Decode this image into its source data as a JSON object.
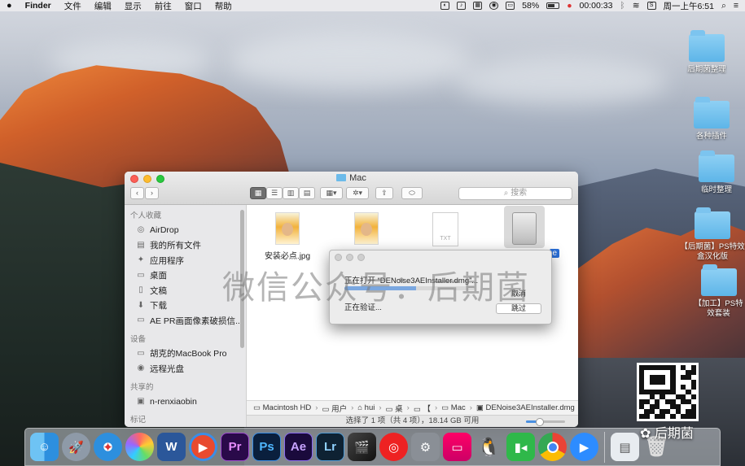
{
  "menubar": {
    "apple": "",
    "app_name": "Finder",
    "menus": [
      "文件",
      "编辑",
      "显示",
      "前往",
      "窗口",
      "帮助"
    ],
    "battery": "58%",
    "timer": "00:00:33",
    "clock": "周一上午6:51"
  },
  "desktop": {
    "items": [
      "后期菌整理",
      "各种插件",
      "临时整理",
      "【后期菌】PS特效盒汉化版",
      "【加工】PS特效套装"
    ]
  },
  "finder": {
    "title": "Mac",
    "search_placeholder": "搜索",
    "sidebar": {
      "favorites_header": "个人收藏",
      "favorites": [
        "AirDrop",
        "我的所有文件",
        "应用程序",
        "桌面",
        "文稿",
        "下载",
        "AE PR画面像素破损信..."
      ],
      "devices_header": "设备",
      "devices": [
        "胡克的MacBook Pro",
        "远程光盘"
      ],
      "shared_header": "共享的",
      "shared": [
        "n-renxiaobin"
      ],
      "tags_header": "标记"
    },
    "files": [
      {
        "name": "安装必点.jpg",
        "kind": "image"
      },
      {
        "name": "",
        "kind": "image"
      },
      {
        "name": "",
        "kind": "txt",
        "badge": "TXT"
      },
      {
        "name": "",
        "kind": "dmg",
        "selected": true,
        "selected_label_tail": "e"
      }
    ],
    "path": [
      "Macintosh HD",
      "用户",
      "hui",
      "桌面",
      "【",
      "Mac",
      "DENoise3AEInstaller.dmg"
    ],
    "path_display": [
      "Macintosh HD",
      "用户",
      "hui",
      "桌",
      "【",
      "Mac",
      "DENoise3AEInstaller.dmg"
    ],
    "status": "选择了 1 项（共 4 项），18.14 GB 可用",
    "zoom_level": 0.3
  },
  "dialog": {
    "title": "正在打开 “DENoise3AEInstaller.dmg”...",
    "progress": 0.55,
    "cancel_label": "取消",
    "status": "正在验证...",
    "skip_label": "跳过"
  },
  "watermark": "微信公众号：后期菌",
  "wechat_badge": "后期菌",
  "dock": {
    "apps": [
      "Finder",
      "Launchpad",
      "Safari",
      "Photos",
      "Word",
      "Video Player",
      "Premiere",
      "Photoshop",
      "After Effects",
      "Lightroom",
      "Final Cut Pro",
      "NetEase Music",
      "System Preferences",
      "CleanMyMac",
      "QQ",
      "FaceTime",
      "Chrome",
      "Zoom",
      "Trash"
    ],
    "labels": {
      "premiere": "Pr",
      "photoshop": "Ps",
      "after_effects": "Ae",
      "lightroom": "Lr",
      "word": "W"
    }
  },
  "colors": {
    "accent_blue": "#2a6fd8",
    "folder_blue": "#5db5e8",
    "premiere": "#2a0a4a",
    "photoshop": "#0a1f3d",
    "after_effects": "#1a0a3c",
    "lightroom": "#0e2233"
  }
}
